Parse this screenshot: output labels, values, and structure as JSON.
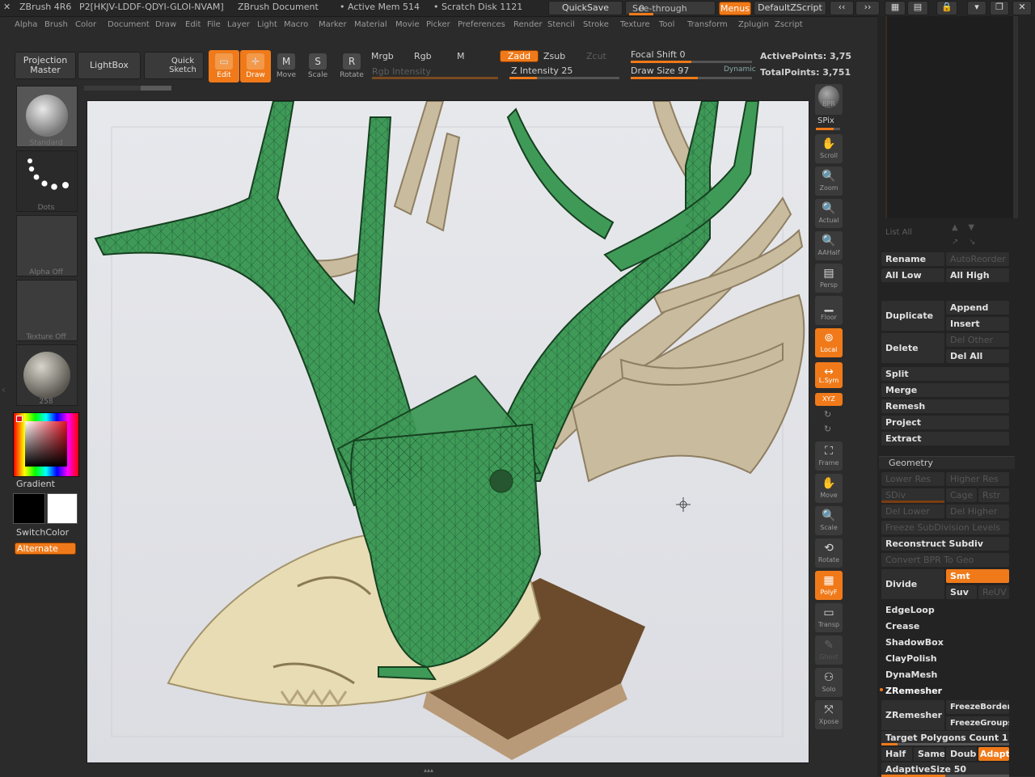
{
  "titlebar": {
    "app": "ZBrush 4R6",
    "doc_id": "P2[HKJV-LDDF-QDYI-GLOI-NVAM]",
    "doc": "ZBrush Document",
    "active_mem": "• Active Mem 514",
    "scratch": "• Scratch Disk 1121",
    "quicksave": "QuickSave",
    "see_through": "See-through",
    "see_through_val": "0",
    "menus": "Menus",
    "script": "DefaultZScript"
  },
  "menu": [
    "Alpha",
    "Brush",
    "Color",
    "Document",
    "Draw",
    "Edit",
    "File",
    "Layer",
    "Light",
    "Macro",
    "Marker",
    "Material",
    "Movie",
    "Picker",
    "Preferences",
    "Render",
    "Stencil",
    "Stroke",
    "Texture",
    "Tool",
    "Transform",
    "Zplugin",
    "Zscript"
  ],
  "toolbar": {
    "projection_master": "Projection Master",
    "lightbox": "LightBox",
    "quick_sketch": "Quick Sketch",
    "edit": "Edit",
    "draw": "Draw",
    "move": "Move",
    "scale": "Scale",
    "rotate": "Rotate",
    "mrgb": "Mrgb",
    "rgb": "Rgb",
    "m": "M",
    "rgb_intensity": "Rgb Intensity",
    "zadd": "Zadd",
    "zsub": "Zsub",
    "zcut": "Zcut",
    "z_intensity": "Z Intensity 25",
    "z_intensity_value": 0.25,
    "focal_shift": "Focal Shift 0",
    "focal_shift_value": 0.5,
    "draw_size": "Draw Size 97",
    "draw_size_value": 0.55,
    "dynamic": "Dynamic",
    "active_points": "ActivePoints: 3,75",
    "total_points": "TotalPoints: 3,751"
  },
  "left": {
    "standard": "Standard",
    "dots": "Dots",
    "alpha_off": "Alpha Off",
    "texture_off": "Texture Off",
    "material": "258",
    "gradient": "Gradient",
    "switchcolor": "SwitchColor",
    "alternate": "Alternate"
  },
  "right_tools": {
    "bpr": "BPR",
    "spix": "SPix",
    "scroll": "Scroll",
    "zoom": "Zoom",
    "actual": "Actual",
    "aahalf": "AAHalf",
    "persp": "Persp",
    "floor": "Floor",
    "local": "Local",
    "lsym": "L.Sym",
    "xyz": "XYZ",
    "frame": "Frame",
    "move": "Move",
    "scale": "Scale",
    "rotate": "Rotate",
    "polyf": "PolyF",
    "transp": "Transp",
    "ghost": "Ghost",
    "solo": "Solo",
    "xpose": "Xpose"
  },
  "subtool": {
    "list_all": "List All",
    "rename": "Rename",
    "autoreorder": "AutoReorder",
    "all_low": "All Low",
    "all_high": "All High",
    "duplicate": "Duplicate",
    "append": "Append",
    "insert": "Insert",
    "delete": "Delete",
    "del_other": "Del Other",
    "del_all": "Del All",
    "split": "Split",
    "merge": "Merge",
    "remesh": "Remesh",
    "project": "Project",
    "extract": "Extract"
  },
  "geometry": {
    "header": "Geometry",
    "lower_res": "Lower Res",
    "higher_res": "Higher Res",
    "sdiv": "SDiv",
    "cage": "Cage",
    "rstr": "Rstr",
    "del_lower": "Del Lower",
    "del_higher": "Del Higher",
    "freeze": "Freeze SubDivision Levels",
    "reconstruct": "Reconstruct Subdiv",
    "convert_bpr": "Convert BPR To Geo",
    "divide": "Divide",
    "smt": "Smt",
    "suv": "Suv",
    "reuv": "ReUV",
    "edgeloop": "EdgeLoop",
    "crease": "Crease",
    "shadowbox": "ShadowBox",
    "claypolish": "ClayPolish",
    "dynamesh": "DynaMesh",
    "zremesher_header": "ZRemesher",
    "zremesher": "ZRemesher",
    "freeze_border": "FreezeBorder",
    "freeze_groups": "FreezeGroups",
    "target_polys": "Target Polygons Count 1",
    "half": "Half",
    "same": "Same",
    "double": "Double",
    "adapt": "Adapt",
    "adaptive_size": "AdaptiveSize 50"
  },
  "colors": {
    "accent": "#f07a1a",
    "mesh": "#3f9a58",
    "bone": "#e8dcb4"
  }
}
